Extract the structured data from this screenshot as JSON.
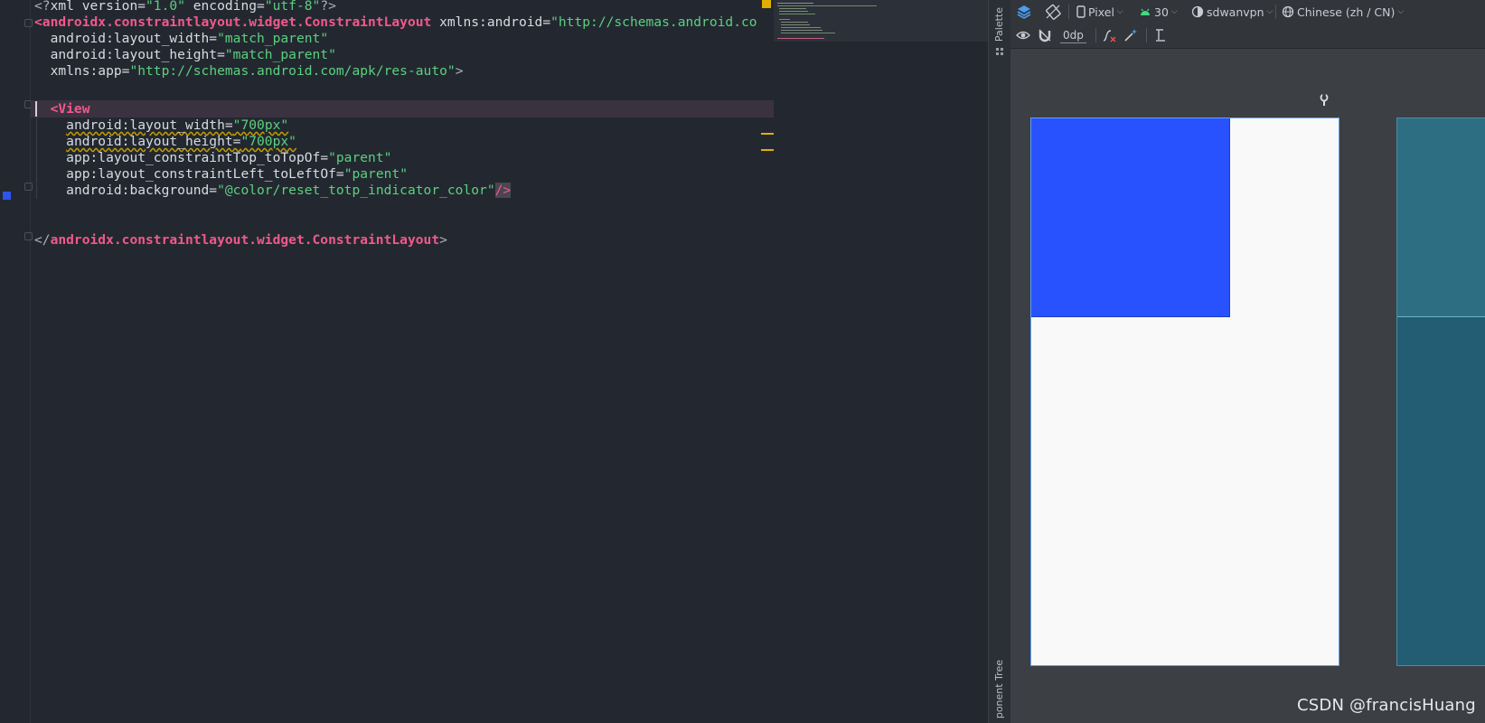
{
  "code": {
    "lines": [
      {
        "t": "<?xml version=\"1.0\" encoding=\"utf-8\"?>"
      },
      {
        "t": "<androidx.constraintlayout.widget.ConstraintLayout xmlns:android=\"http://schemas.android.co"
      },
      {
        "t": "  android:layout_width=\"match_parent\""
      },
      {
        "t": "  android:layout_height=\"match_parent\""
      },
      {
        "t": "  xmlns:app=\"http://schemas.android.com/apk/res-auto\">"
      },
      {
        "t": ""
      },
      {
        "t": "  <View"
      },
      {
        "t": "    android:layout_width=\"700px\""
      },
      {
        "t": "    android:layout_height=\"700px\""
      },
      {
        "t": "    app:layout_constraintTop_toTopOf=\"parent\""
      },
      {
        "t": "    app:layout_constraintLeft_toLeftOf=\"parent\""
      },
      {
        "t": "    android:background=\"@color/reset_totp_indicator_color\"/>"
      },
      {
        "t": ""
      },
      {
        "t": ""
      },
      {
        "t": "</androidx.constraintlayout.widget.ConstraintLayout>"
      }
    ],
    "parts": {
      "l0": [
        "<?",
        "xml version=",
        "\"1.0\"",
        " encoding=",
        "\"utf-8\"",
        "?>"
      ],
      "l1_tag": "<androidx.constraintlayout.widget.ConstraintLayout",
      "l1_attr": " xmlns:android=",
      "l1_val": "\"http://schemas.android.co",
      "l2_attr": "android:layout_width=",
      "l2_val": "\"match_parent\"",
      "l3_attr": "android:layout_height=",
      "l3_val": "\"match_parent\"",
      "l4_attr": "xmlns:app=",
      "l4_val": "\"http://schemas.android.com/apk/res-auto\"",
      "l4_end": ">",
      "l6_tag": "<View",
      "l7_attr": "android:layout_width=",
      "l7_val": "\"700px\"",
      "l8_attr": "android:layout_height=",
      "l8_val": "\"700px\"",
      "l9_attr": "app:layout_constraintTop_toTopOf=",
      "l9_val": "\"parent\"",
      "l10_attr": "app:layout_constraintLeft_toLeftOf=",
      "l10_val": "\"parent\"",
      "l11_attr": "android:background=",
      "l11_val": "\"@color/reset_totp_indicator_color\"",
      "l11_end": "/>",
      "l14_open": "</",
      "l14_tag": "androidx.constraintlayout.widget.ConstraintLayout",
      "l14_end": ">"
    }
  },
  "side_tabs": {
    "palette": "Palette",
    "component_tree": "ponent Tree"
  },
  "toolbar": {
    "device": "Pixel",
    "api": "30",
    "theme": "sdwanvpn",
    "locale": "Chinese (zh / CN)",
    "margin": "0dp"
  },
  "icons": {
    "layers": "layers-icon",
    "orientation": "orientation-icon",
    "device": "phone-icon",
    "api": "android-icon",
    "theme": "theme-icon",
    "locale": "globe-icon",
    "eye": "eye-icon",
    "magnet": "magnet-icon",
    "clear_constraints": "clear-constraints-icon",
    "infer": "magic-wand-icon",
    "guidelines": "guidelines-icon",
    "wrench": "wrench-icon"
  },
  "colors": {
    "view_background": "#2952ff",
    "editor_bg": "#232830",
    "tag": "#f0598c",
    "string": "#4cd964"
  },
  "watermark": "CSDN @francisHuang"
}
